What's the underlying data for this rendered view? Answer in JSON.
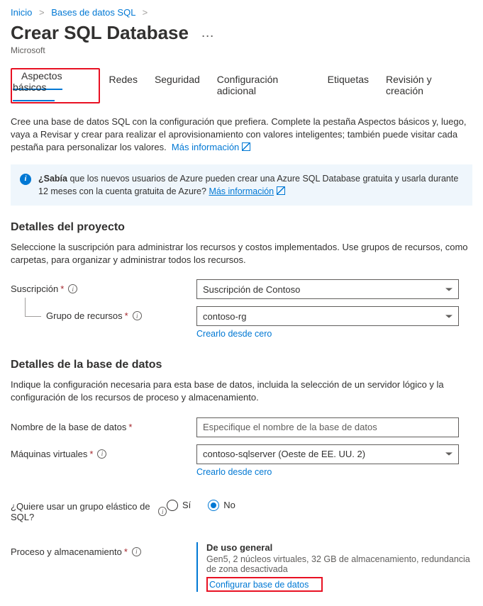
{
  "breadcrumb": {
    "home": "Inicio",
    "parent": "Bases de datos SQL"
  },
  "header": {
    "title": "Crear SQL Database",
    "publisher": "Microsoft"
  },
  "tabs": {
    "basics": "Aspectos básicos",
    "networking": "Redes",
    "security": "Seguridad",
    "additional": "Configuración adicional",
    "tags": "Etiquetas",
    "review": "Revisión y creación"
  },
  "intro": {
    "text": "Cree una base de datos SQL con la configuración que prefiera. Complete la pestaña Aspectos básicos y, luego, vaya a Revisar y crear para realizar el aprovisionamiento con valores inteligentes; también puede visitar cada pestaña para personalizar los valores.",
    "link": "Más información"
  },
  "infobox": {
    "bold": "¿Sabía",
    "text": " que los nuevos usuarios de Azure pueden crear una Azure SQL Database gratuita y usarla durante 12 meses con la cuenta gratuita de Azure? ",
    "link": "Más información"
  },
  "project": {
    "title": "Detalles del proyecto",
    "desc": "Seleccione la suscripción para administrar los recursos y costos implementados. Use grupos de recursos, como carpetas, para organizar y administrar todos los recursos.",
    "subscription_label": "Suscripción",
    "subscription_value": "Suscripción de Contoso",
    "rg_label": "Grupo de recursos",
    "rg_value": "contoso-rg",
    "rg_create": "Crearlo desde cero"
  },
  "database": {
    "title": "Detalles de la base de datos",
    "desc": "Indique la configuración necesaria para esta base de datos, incluida la selección de un servidor lógico y la configuración de los recursos de proceso y almacenamiento.",
    "name_label": "Nombre de la base de datos",
    "name_placeholder": "Especifique el nombre de la base de datos",
    "server_label": "Máquinas virtuales",
    "server_value": "contoso-sqlserver (Oeste de EE. UU. 2)",
    "server_create": "Crearlo desde cero",
    "elastic_label": "¿Quiere usar un grupo elástico de SQL?",
    "elastic_yes": "Sí",
    "elastic_no": "No",
    "compute_label": "Proceso y almacenamiento",
    "compute_title": "De uso general",
    "compute_sub": "Gen5, 2 núcleos virtuales, 32 GB de almacenamiento, redundancia de zona desactivada",
    "compute_link": "Configurar base de datos"
  }
}
